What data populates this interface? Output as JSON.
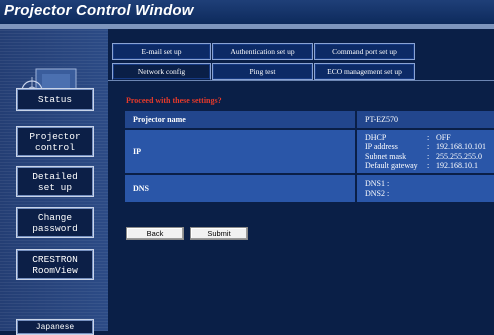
{
  "window": {
    "title": "Projector Control Window"
  },
  "colors": {
    "background": "#0a1f47",
    "panel": "#2a56a8",
    "notice": "#e63a2a",
    "nav_button": "#0c1f47"
  },
  "nav": {
    "items": [
      {
        "label": "Status"
      },
      {
        "label": "Projector\ncontrol"
      },
      {
        "label": "Detailed\nset up"
      },
      {
        "label": "Change\npassword"
      },
      {
        "label": "CRESTRON\nRoomView"
      },
      {
        "label": "Japanese"
      }
    ]
  },
  "tabs": {
    "row1": [
      {
        "label": "E-mail set up"
      },
      {
        "label": "Authentication set up"
      },
      {
        "label": "Command port set up"
      }
    ],
    "row2": [
      {
        "label": "Network config",
        "active": true
      },
      {
        "label": "Ping test"
      },
      {
        "label": "ECO management set up"
      }
    ]
  },
  "main": {
    "notice": "Proceed with these settings?",
    "rows": {
      "projector_name": {
        "label": "Projector name",
        "value": "PT-EZ570"
      },
      "ip": {
        "label": "IP",
        "dhcp": {
          "key": "DHCP",
          "sep": ":",
          "value": "OFF"
        },
        "ip_address": {
          "key": "IP address",
          "sep": ":",
          "value": "192.168.10.101"
        },
        "subnet_mask": {
          "key": "Subnet mask",
          "sep": ":",
          "value": "255.255.255.0"
        },
        "default_gateway": {
          "key": "Default gateway",
          "sep": ":",
          "value": "192.168.10.1"
        }
      },
      "dns": {
        "label": "DNS",
        "dns1": "DNS1 :",
        "dns2": "DNS2 :"
      }
    },
    "buttons": {
      "back": "Back",
      "submit": "Submit"
    }
  }
}
